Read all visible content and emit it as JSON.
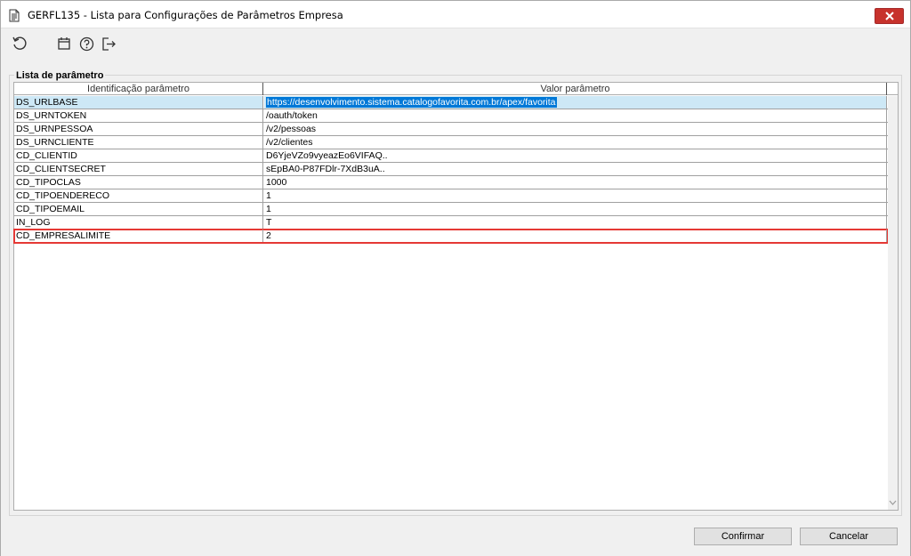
{
  "window": {
    "title": "GERFL135 - Lista para Configurações de Parâmetros Empresa"
  },
  "toolbar": {
    "items": [
      {
        "icon": "refresh-icon"
      },
      {
        "icon": "calendar-icon"
      },
      {
        "icon": "help-icon"
      },
      {
        "icon": "exit-icon"
      }
    ]
  },
  "group": {
    "legend": "Lista de parâmetro"
  },
  "grid": {
    "columns": [
      "Identificação parâmetro",
      "Valor parâmetro"
    ],
    "rows": [
      {
        "key": "DS_URLBASE",
        "value": "https://desenvolvimento.sistema.catalogofavorita.com.br/apex/favorita"
      },
      {
        "key": "DS_URNTOKEN",
        "value": "/oauth/token"
      },
      {
        "key": "DS_URNPESSOA",
        "value": "/v2/pessoas"
      },
      {
        "key": "DS_URNCLIENTE",
        "value": "/v2/clientes"
      },
      {
        "key": "CD_CLIENTID",
        "value": "D6YjeVZo9vyeazEo6VIFAQ.."
      },
      {
        "key": "CD_CLIENTSECRET",
        "value": "sEpBA0-P87FDlr-7XdB3uA.."
      },
      {
        "key": "CD_TIPOCLAS",
        "value": "1000"
      },
      {
        "key": "CD_TIPOENDERECO",
        "value": "1"
      },
      {
        "key": "CD_TIPOEMAIL",
        "value": "1"
      },
      {
        "key": "IN_LOG",
        "value": "T"
      },
      {
        "key": "CD_EMPRESALIMITE",
        "value": "2"
      }
    ],
    "selected_row": 0,
    "highlighted_row": 10
  },
  "footer": {
    "confirm_label": "Confirmar",
    "cancel_label": "Cancelar"
  },
  "colors": {
    "selection": "#0078d7",
    "highlight_border": "#e53935",
    "close_button": "#c7322c"
  }
}
